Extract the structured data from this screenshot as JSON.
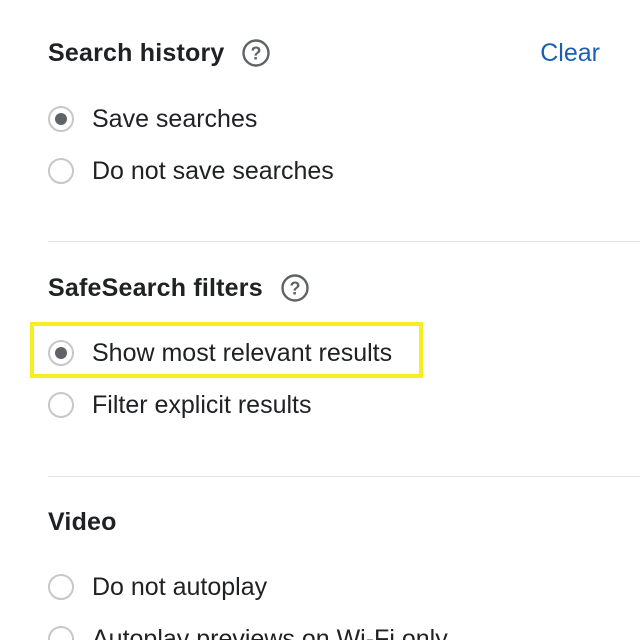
{
  "search_history": {
    "title": "Search history",
    "help_icon": "help-circle-icon",
    "clear_label": "Clear",
    "options": [
      {
        "label": "Save searches",
        "selected": true
      },
      {
        "label": "Do not save searches",
        "selected": false
      }
    ]
  },
  "safesearch": {
    "title": "SafeSearch filters",
    "help_icon": "help-circle-icon",
    "options": [
      {
        "label": "Show most relevant results",
        "selected": true,
        "highlighted": true
      },
      {
        "label": "Filter explicit results",
        "selected": false
      }
    ]
  },
  "video": {
    "title": "Video",
    "options": [
      {
        "label": "Do not autoplay",
        "selected": false
      },
      {
        "label": "Autoplay previews on Wi-Fi only",
        "selected": false
      }
    ]
  },
  "colors": {
    "link": "#1a5fb4",
    "highlight_border": "#f6ee1e",
    "radio_dot": "#5f6368",
    "radio_border": "#c7c7c7"
  }
}
